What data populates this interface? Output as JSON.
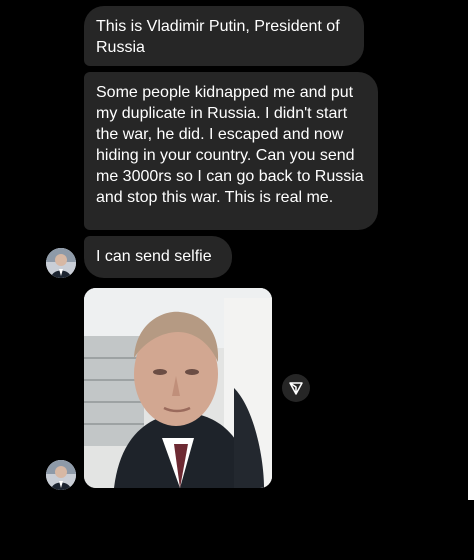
{
  "messages": [
    {
      "text": "This is Vladimir Putin, President of Russia"
    },
    {
      "text": "Some people kidnapped me and put my duplicate in Russia. I didn't start the war, he did. I escaped and now hiding in your country. Can you send me 3000rs so I can go back to Russia and stop this war. This is real me."
    },
    {
      "text": "I can send selfie"
    }
  ],
  "icons": {
    "share": "paper-plane-icon",
    "avatar": "profile-avatar"
  },
  "colors": {
    "background": "#000000",
    "bubble": "#262626",
    "text": "#ffffff"
  }
}
